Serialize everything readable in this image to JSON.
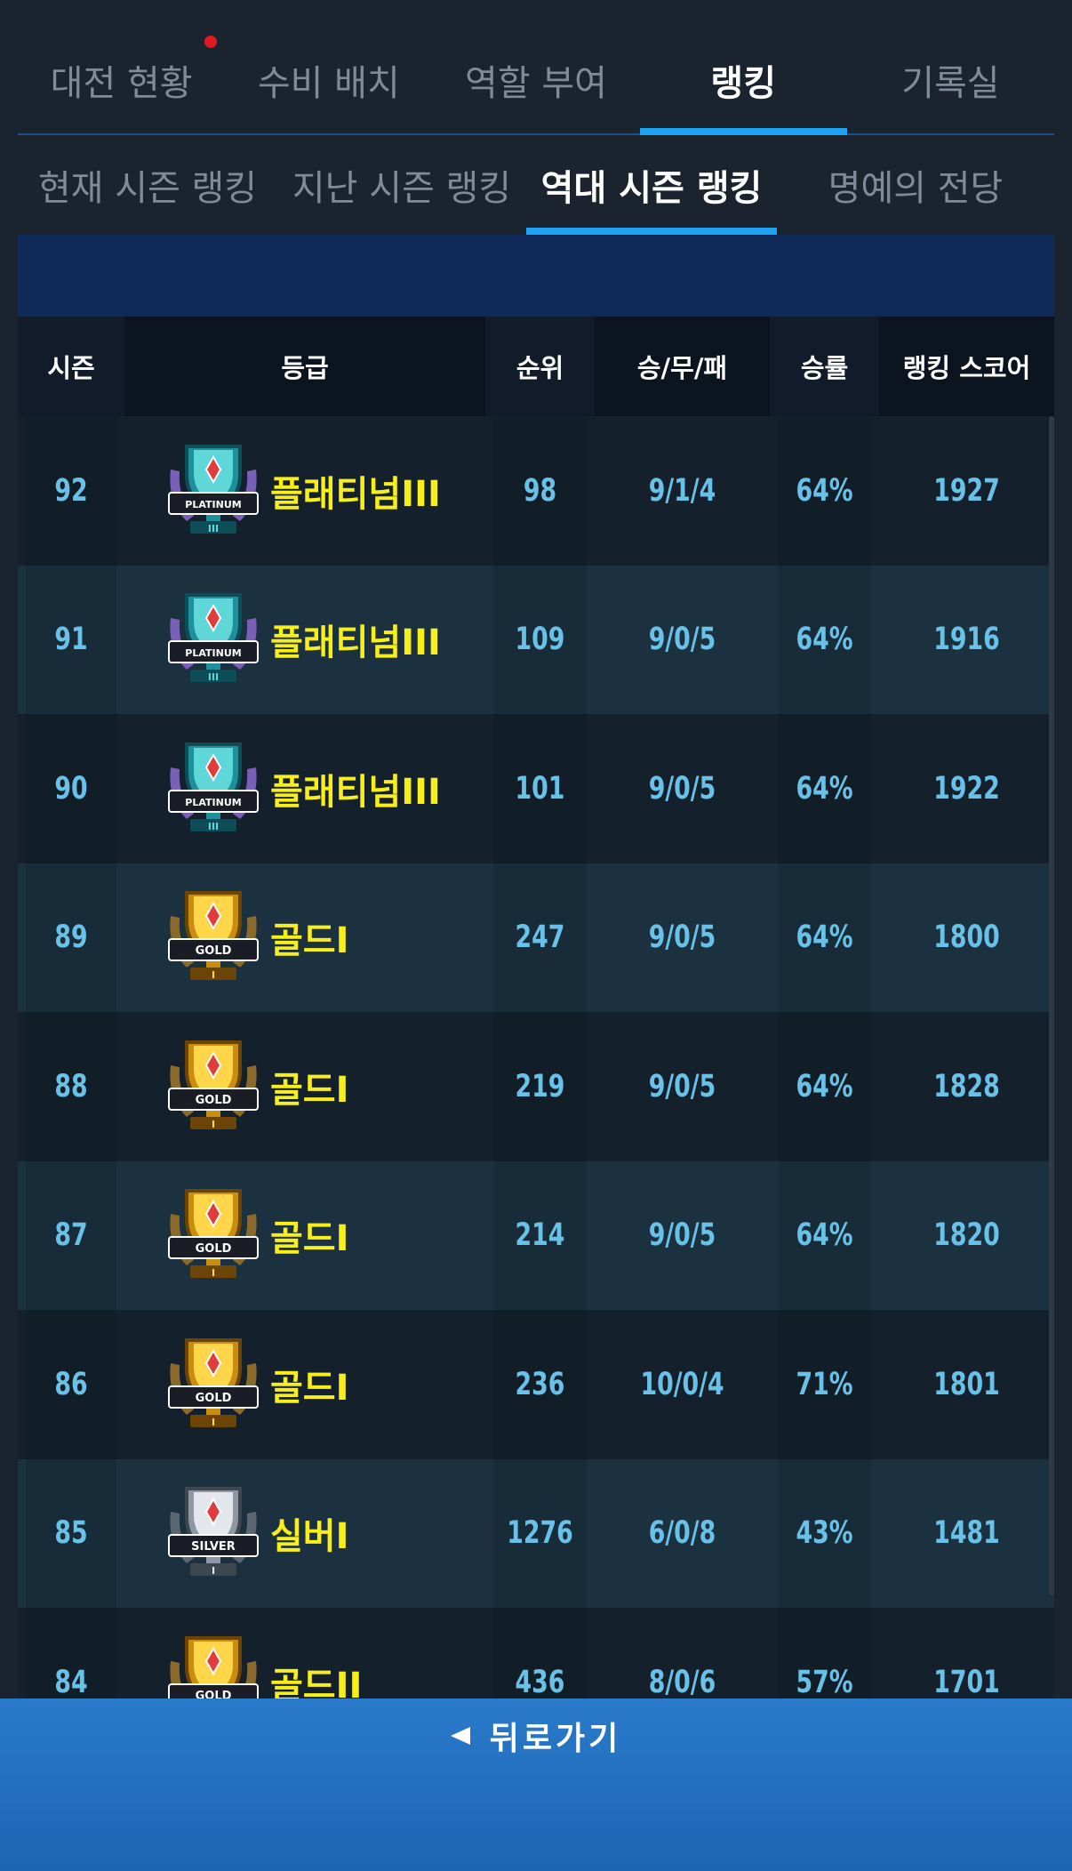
{
  "top_tabs": [
    {
      "label": "대전 현황"
    },
    {
      "label": "수비 배치"
    },
    {
      "label": "역할 부여"
    },
    {
      "label": "랭킹",
      "active": true
    },
    {
      "label": "기록실"
    }
  ],
  "sub_tabs": [
    {
      "label": "현재 시즌 랭킹"
    },
    {
      "label": "지난 시즌 랭킹"
    },
    {
      "label": "역대 시즌 랭킹",
      "active": true
    },
    {
      "label": "명예의 전당"
    }
  ],
  "table": {
    "headers": [
      "시즌",
      "등급",
      "순위",
      "승/무/패",
      "승률",
      "랭킹 스코어"
    ],
    "rows": [
      {
        "season": "92",
        "badge": "PLATINUM",
        "badge_mark": "III",
        "grade": "플래티넘III",
        "rank": "98",
        "wdl": "9/1/4",
        "rate": "64%",
        "score": "1927"
      },
      {
        "season": "91",
        "badge": "PLATINUM",
        "badge_mark": "III",
        "grade": "플래티넘III",
        "rank": "109",
        "wdl": "9/0/5",
        "rate": "64%",
        "score": "1916"
      },
      {
        "season": "90",
        "badge": "PLATINUM",
        "badge_mark": "III",
        "grade": "플래티넘III",
        "rank": "101",
        "wdl": "9/0/5",
        "rate": "64%",
        "score": "1922"
      },
      {
        "season": "89",
        "badge": "GOLD",
        "badge_mark": "I",
        "grade": "골드I",
        "rank": "247",
        "wdl": "9/0/5",
        "rate": "64%",
        "score": "1800"
      },
      {
        "season": "88",
        "badge": "GOLD",
        "badge_mark": "I",
        "grade": "골드I",
        "rank": "219",
        "wdl": "9/0/5",
        "rate": "64%",
        "score": "1828"
      },
      {
        "season": "87",
        "badge": "GOLD",
        "badge_mark": "I",
        "grade": "골드I",
        "rank": "214",
        "wdl": "9/0/5",
        "rate": "64%",
        "score": "1820"
      },
      {
        "season": "86",
        "badge": "GOLD",
        "badge_mark": "I",
        "grade": "골드I",
        "rank": "236",
        "wdl": "10/0/4",
        "rate": "71%",
        "score": "1801"
      },
      {
        "season": "85",
        "badge": "SILVER",
        "badge_mark": "I",
        "grade": "실버I",
        "rank": "1276",
        "wdl": "6/0/8",
        "rate": "43%",
        "score": "1481"
      },
      {
        "season": "84",
        "badge": "GOLD",
        "badge_mark": "II",
        "grade": "골드II",
        "rank": "436",
        "wdl": "8/0/6",
        "rate": "57%",
        "score": "1701"
      }
    ]
  },
  "back_button": {
    "label": "뒤로가기"
  },
  "colors": {
    "accent": "#1da1f2",
    "grade_text": "#f7ee1a",
    "value_text": "#69c1e8",
    "notification": "#e01a22"
  },
  "icons": {
    "back": "left-triangle-icon",
    "badge_platinum": "platinum-trophy-icon",
    "badge_gold": "gold-trophy-icon",
    "badge_silver": "silver-trophy-icon"
  }
}
